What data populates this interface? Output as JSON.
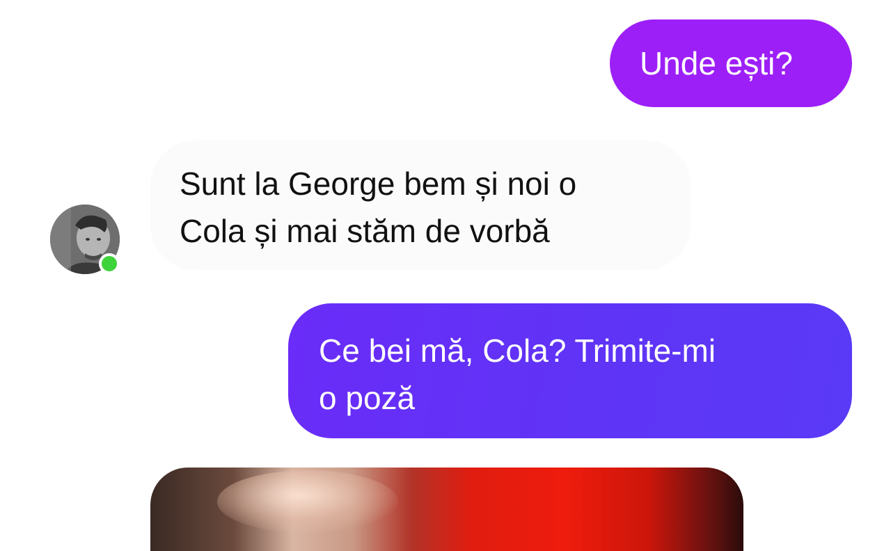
{
  "conversation": {
    "messages": [
      {
        "direction": "outgoing",
        "lines": [
          "Unde ești?"
        ],
        "color": "#9d1ff7"
      },
      {
        "direction": "incoming",
        "lines": [
          "Sunt la George bem și noi o",
          "Cola și mai stăm de vorbă"
        ],
        "color": "#fbfbfb"
      },
      {
        "direction": "outgoing",
        "lines": [
          "Ce bei mă, Cola? Trimite-mi",
          "o poză"
        ],
        "color": "#6a2cf8"
      }
    ],
    "contact": {
      "avatar_icon": "user-photo-avatar",
      "online": true,
      "online_color": "#3fd33b"
    },
    "attachment": {
      "type": "photo",
      "icon": "image-photo"
    }
  }
}
